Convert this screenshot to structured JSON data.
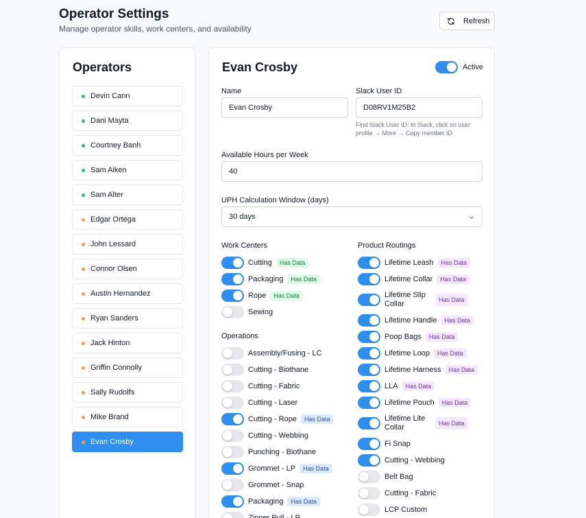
{
  "header": {
    "title": "Operator Settings",
    "subtitle": "Manage operator skills, work centers, and availability",
    "refresh_label": "Refresh"
  },
  "operators": {
    "title": "Operators",
    "items": [
      {
        "name": "Devin Cann",
        "status": "green"
      },
      {
        "name": "Dani Mayta",
        "status": "green"
      },
      {
        "name": "Courtney Banh",
        "status": "green"
      },
      {
        "name": "Sam Aiken",
        "status": "green"
      },
      {
        "name": "Sam Alter",
        "status": "green"
      },
      {
        "name": "Edgar Ortega",
        "status": "orange"
      },
      {
        "name": "John Lessard",
        "status": "orange"
      },
      {
        "name": "Connor Olsen",
        "status": "orange"
      },
      {
        "name": "Austin Hernandez",
        "status": "orange"
      },
      {
        "name": "Ryan Sanders",
        "status": "orange"
      },
      {
        "name": "Jack Hinton",
        "status": "orange"
      },
      {
        "name": "Griffin Connolly",
        "status": "orange"
      },
      {
        "name": "Sally Rudolfs",
        "status": "orange"
      },
      {
        "name": "Mike Brand",
        "status": "orange"
      },
      {
        "name": "Evan Crosby",
        "status": "orange",
        "selected": true
      }
    ]
  },
  "detail": {
    "name": "Evan Crosby",
    "active_label": "Active",
    "active": true,
    "name_label": "Name",
    "name_value": "Evan Crosby",
    "slack_label": "Slack User ID",
    "slack_value": "D08RV1M25B2",
    "slack_hint": "Find Slack User ID: In Slack, click on user profile → More → Copy member ID",
    "hours_label": "Available Hours per Week",
    "hours_value": "40",
    "uph_label": "UPH Calculation Window (days)",
    "uph_value": "30 days",
    "work_centers_title": "Work Centers",
    "work_centers": [
      {
        "label": "Cutting",
        "on": true,
        "badge": "Has Data"
      },
      {
        "label": "Packaging",
        "on": true,
        "badge": "Has Data"
      },
      {
        "label": "Rope",
        "on": true,
        "badge": "Has Data"
      },
      {
        "label": "Sewing",
        "on": false,
        "badge": ""
      }
    ],
    "operations_title": "Operations",
    "operations": [
      {
        "label": "Assembly/Fusing - LC",
        "on": false,
        "badge": ""
      },
      {
        "label": "Cutting - Biothane",
        "on": false,
        "badge": ""
      },
      {
        "label": "Cutting - Fabric",
        "on": false,
        "badge": ""
      },
      {
        "label": "Cutting - Laser",
        "on": false,
        "badge": ""
      },
      {
        "label": "Cutting - Rope",
        "on": true,
        "badge": "Has Data"
      },
      {
        "label": "Cutting - Webbing",
        "on": false,
        "badge": ""
      },
      {
        "label": "Punching - Biothane",
        "on": false,
        "badge": ""
      },
      {
        "label": "Grommet - LP",
        "on": true,
        "badge": "Has Data"
      },
      {
        "label": "Grommet - Snap",
        "on": false,
        "badge": ""
      },
      {
        "label": "Packaging",
        "on": true,
        "badge": "Has Data"
      },
      {
        "label": "Zipper Pull - LP",
        "on": false,
        "badge": ""
      }
    ],
    "routings_title": "Product Routings",
    "routings": [
      {
        "label": "Lifetime Leash",
        "on": true,
        "badge": "Has Data"
      },
      {
        "label": "Lifetime Collar",
        "on": true,
        "badge": "Has Data"
      },
      {
        "label": "Lifetime Slip Collar",
        "on": true,
        "badge": "Has Data",
        "tall": true
      },
      {
        "label": "Lifetime Handle",
        "on": true,
        "badge": "Has Data"
      },
      {
        "label": "Poop Bags",
        "on": true,
        "badge": "Has Data"
      },
      {
        "label": "Lifetime Loop",
        "on": true,
        "badge": "Has Data"
      },
      {
        "label": "Lifetime Harness",
        "on": true,
        "badge": "Has Data"
      },
      {
        "label": "LLA",
        "on": true,
        "badge": "Has Data"
      },
      {
        "label": "Lifetime Pouch",
        "on": true,
        "badge": "Has Data"
      },
      {
        "label": "Lifetime Lite Collar",
        "on": true,
        "badge": "Has Data",
        "tall": true
      },
      {
        "label": "Fi Snap",
        "on": true,
        "badge": ""
      },
      {
        "label": "Cutting - Webbing",
        "on": true,
        "badge": ""
      },
      {
        "label": "Belt Bag",
        "on": false,
        "badge": ""
      },
      {
        "label": "Cutting - Fabric",
        "on": false,
        "badge": ""
      },
      {
        "label": "LCP Custom",
        "on": false,
        "badge": ""
      }
    ]
  },
  "colors": {
    "accent": "#2f8ff1",
    "status_green": "#22c55e",
    "status_orange": "#f59e4b"
  }
}
